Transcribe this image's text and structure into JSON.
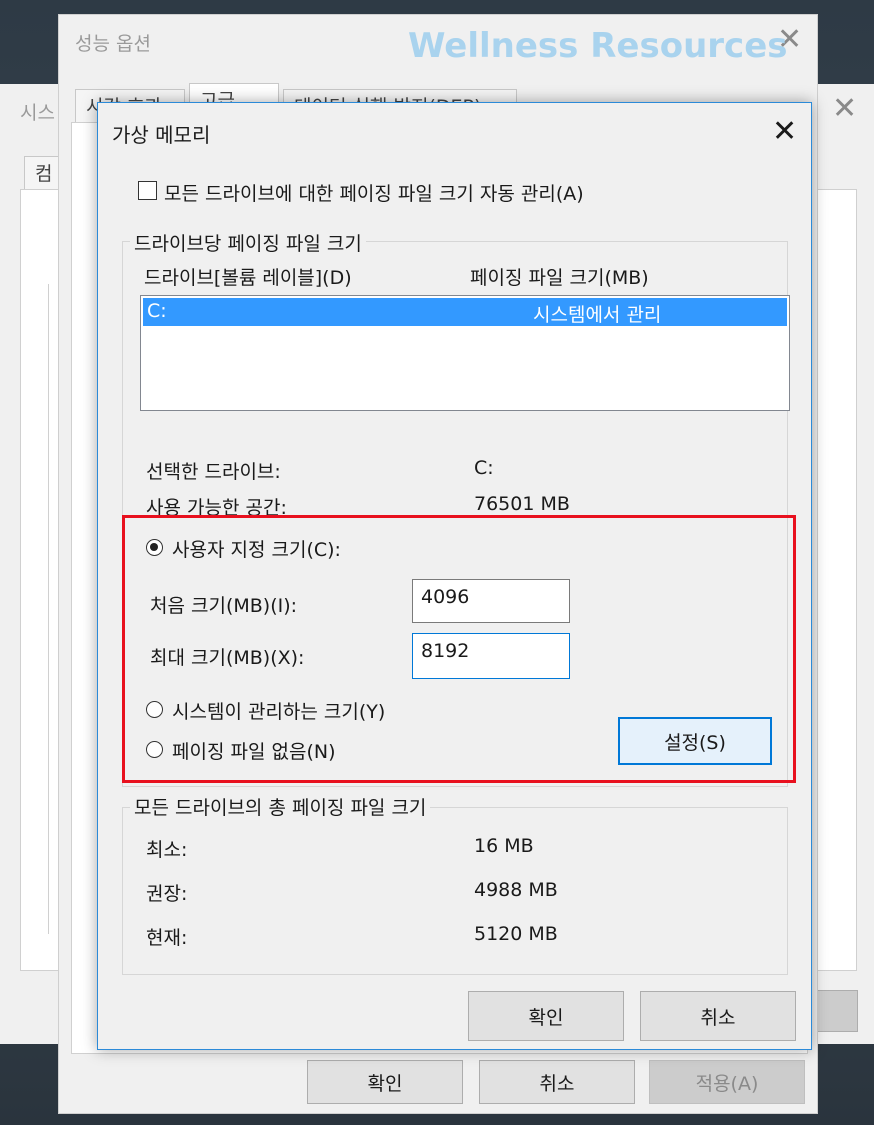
{
  "watermark": "Wellness Resources",
  "back_window": {
    "title": "시스",
    "tab": "컴"
  },
  "perf_window": {
    "title": "성능 옵션",
    "tabs": [
      "시각 효과",
      "고급",
      "데이터 실행 방지(DEP)"
    ],
    "ok": "확인",
    "cancel": "취소",
    "apply": "적용(A)"
  },
  "dialog": {
    "title": "가상 메모리",
    "auto_manage": "모든 드라이브에 대한 페이징 파일 크기 자동 관리(A)",
    "per_drive_group": "드라이브당 페이징 파일 크기",
    "col_drive": "드라이브[볼륨 레이블](D)",
    "col_size": "페이징 파일 크기(MB)",
    "drive_rows": [
      {
        "drive": "C:",
        "size": "시스템에서 관리"
      }
    ],
    "selected_drive_label": "선택한 드라이브:",
    "selected_drive_value": "C:",
    "space_label": "사용 가능한 공간:",
    "space_value": "76501 MB",
    "custom_size": "사용자 지정 크기(C):",
    "initial_label": "처음 크기(MB)(I):",
    "initial_value": "4096",
    "max_label": "최대 크기(MB)(X):",
    "max_value": "8192",
    "system_managed": "시스템이 관리하는 크기(Y)",
    "no_paging": "페이징 파일 없음(N)",
    "set_button": "설정(S)",
    "total_group": "모든 드라이브의 총 페이징 파일 크기",
    "min_label": "최소:",
    "min_value": "16 MB",
    "recommended_label": "권장:",
    "recommended_value": "4988 MB",
    "current_label": "현재:",
    "current_value": "5120 MB",
    "ok": "확인",
    "cancel": "취소"
  },
  "colors": {
    "selection": "#3399ff",
    "highlight_box": "#e8101e",
    "focus_border": "#0078d7"
  }
}
